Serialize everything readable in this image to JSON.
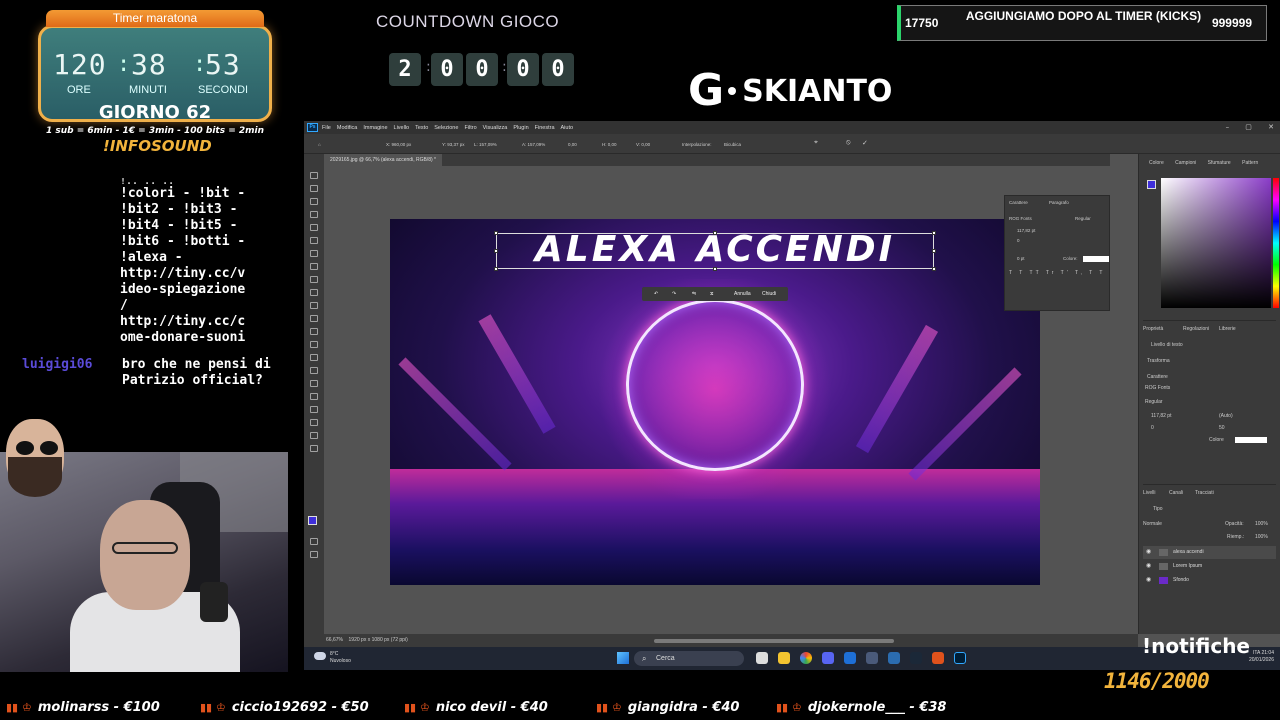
{
  "timer": {
    "title": "Timer maratona",
    "hours": "120",
    "minutes": "38",
    "seconds": "53",
    "hours_label": "ORE",
    "minutes_label": "MINUTI",
    "seconds_label": "SECONDI",
    "day": "GIORNO 62",
    "rules": "1 sub = 6min - 1€ = 3min - 100 bits = 2min"
  },
  "countdown": {
    "title": "COUNTDOWN GIOCO",
    "digits": [
      "2",
      "0",
      "0",
      "0",
      "0"
    ]
  },
  "logo": {
    "letter": "G",
    "name": "SKIANTO"
  },
  "goal": {
    "current": "17750",
    "text": "AGGIUNGIAMO DOPO AL TIMER (KICKS)",
    "target": "999999",
    "accent": "#2bd46b"
  },
  "infosound": "!INFOSOUND",
  "chat": {
    "cut_line": "!.. .. ..",
    "lines": [
      "!colori - !bit -",
      "!bit2 - !bit3 -",
      "!bit4 - !bit5 -",
      "!bit6 - !botti -",
      "!alexa -",
      "http://tiny.cc/v",
      "ideo-spiegazione",
      "/",
      "http://tiny.cc/c",
      "ome-donare-suoni"
    ],
    "user": "luigigi06",
    "message": "bro che ne pensi di Patrizio official?"
  },
  "photoshop": {
    "menu": [
      "File",
      "Modifica",
      "Immagine",
      "Livello",
      "Testo",
      "Selezione",
      "Filtro",
      "Visualizza",
      "Plugin",
      "Finestra",
      "Aiuto"
    ],
    "options": {
      "x": "X: 960,00 px",
      "y": "Y: 93,37 px",
      "w": "L: 157,09%",
      "h": "A: 157,09%",
      "angle": "0,00",
      "h_skew": "H: 0,00",
      "v_skew": "V: 0,00",
      "interp_label": "Interpolazione:",
      "interp_value": "Bicubica"
    },
    "doc_tab": "2029165.jpg @ 66,7% (alexa accendi, RGB/8) *",
    "canvas_text": "ALEXA ACCENDI",
    "transform_bar": {
      "cancel": "Annulla",
      "close": "Chiudi"
    },
    "color_tabs": [
      "Colore",
      "Campioni",
      "Sfumature",
      "Pattern"
    ],
    "char_panel": {
      "tabs": [
        "Carattere",
        "Paragrafo"
      ],
      "font": "ROG Fonts",
      "style": "Regular",
      "size": "117,82 pt",
      "tracking": "0",
      "scale": "0 pt",
      "color_label": "Colore:"
    },
    "props": {
      "tabs": [
        "Proprietà",
        "Regolazioni",
        "Librerie"
      ],
      "layer_kind": "Livello di testo",
      "transform": "Trasforma",
      "character": "Carattere",
      "font": "ROG Fonts",
      "style": "Regular",
      "size": "117,82 pt",
      "leading": "(Auto)",
      "tracking": "0",
      "kerning": "50",
      "color_label": "Colore"
    },
    "layers": {
      "tabs": [
        "Livelli",
        "Canali",
        "Tracciati"
      ],
      "search": "Tipo",
      "blend": "Normale",
      "opacity_label": "Opacità:",
      "opacity": "100%",
      "fill_label": "Riemp.:",
      "fill": "100%",
      "items": [
        "alexa accendi",
        "Lorem Ipsum",
        "Sfondo"
      ]
    },
    "status": {
      "zoom": "66,67%",
      "size": "1920 px x 1080 px (72 ppi)"
    }
  },
  "taskbar": {
    "temp": "8°C",
    "weather": "Nuvoloso",
    "search": "Cerca",
    "lang": "ITA",
    "time": "21:04",
    "date": "20/01/2026"
  },
  "notifiche": "!notifiche",
  "subs": "1146/2000",
  "ticker": [
    "molinarss - €100",
    "ciccio192692 - €50",
    "nico devil - €40",
    "giangidra - €40",
    "djokernole___ - €38"
  ]
}
